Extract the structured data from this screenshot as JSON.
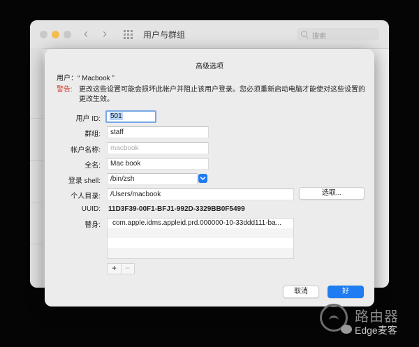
{
  "window": {
    "title": "用户与群组",
    "search_placeholder": "搜索"
  },
  "sheet": {
    "title": "高级选项",
    "user_label": "用户：",
    "user_name": "“ Macbook ”",
    "warning_label": "警告:",
    "warning_text": "更改这些设置可能会损坏此帐户并阻止该用户登录。您必须重新启动电脑才能使对这些设置的更改生效。",
    "fields": {
      "user_id": {
        "label": "用户 ID:",
        "value": "501"
      },
      "group": {
        "label": "群组:",
        "value": "staff"
      },
      "account_name": {
        "label": "帐户名称:",
        "placeholder": "macbook"
      },
      "full_name": {
        "label": "全名:",
        "value": "Mac book"
      },
      "login_shell": {
        "label": "登录 shell:",
        "value": "/bin/zsh"
      },
      "home_dir": {
        "label": "个人目录:",
        "value": "/Users/macbook",
        "choose_label": "选取..."
      },
      "uuid": {
        "label": "UUID:",
        "value": "11D3F39-00F1-BFJ1-992D-3329BB0F5499"
      }
    },
    "aliases": {
      "label": "替身:",
      "items": [
        "com.apple.idms.appleid.prd.000000-10-33ddd111-ba..."
      ]
    },
    "add_label": "+",
    "remove_label": "−",
    "cancel_label": "取消",
    "ok_label": "好"
  },
  "watermark": {
    "line1": "路由器",
    "line2": "Edge麦客"
  }
}
